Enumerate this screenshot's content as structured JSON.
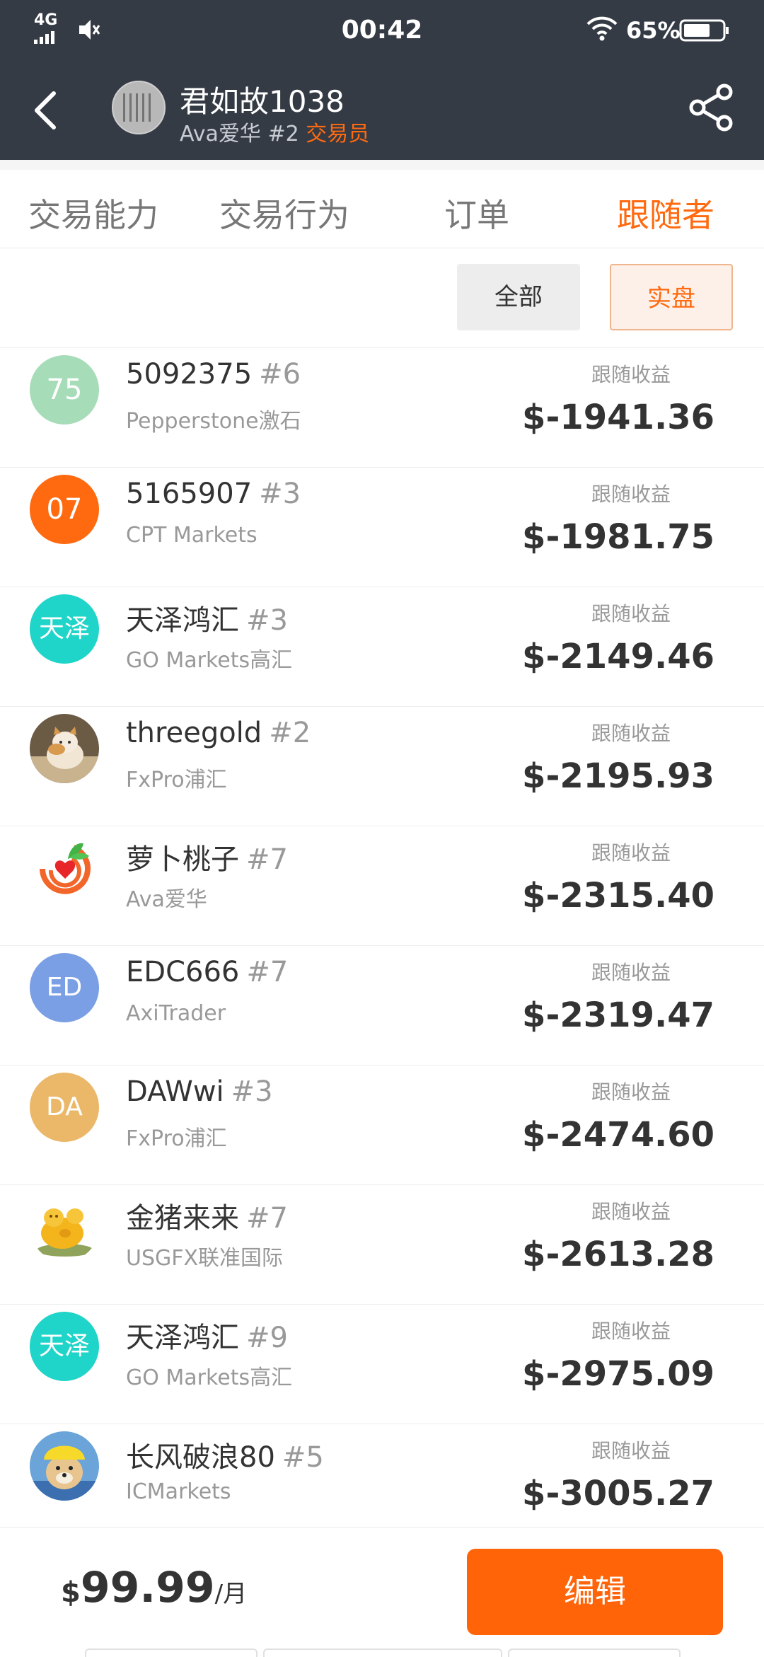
{
  "status": {
    "network": "4G",
    "time": "00:42",
    "battery": "65%"
  },
  "header": {
    "title": "君如故1038",
    "subtitle_broker": "Ava爱华",
    "subtitle_rank": "#2",
    "subtitle_role": "交易员"
  },
  "tabs": [
    {
      "label": "交易能力"
    },
    {
      "label": "交易行为"
    },
    {
      "label": "订单"
    },
    {
      "label": "跟随者",
      "active": true
    }
  ],
  "filters": {
    "all_label": "全部",
    "real_label": "实盘",
    "selected": "实盘"
  },
  "followers": [
    {
      "avatar_text": "75",
      "avatar_color": "#a7dcb8",
      "name": "5092375",
      "rank": "#6",
      "broker": "Pepperstone激石",
      "profit_label": "跟随收益",
      "profit": "$-1941.36"
    },
    {
      "avatar_text": "07",
      "avatar_color": "#ff6a10",
      "name": "5165907",
      "rank": "#3",
      "broker": "CPT Markets",
      "profit_label": "跟随收益",
      "profit": "$-1981.75"
    },
    {
      "avatar_text": "天泽",
      "avatar_color": "#1fd4c8",
      "name": "天泽鸿汇",
      "rank": "#3",
      "broker": "GO Markets高汇",
      "profit_label": "跟随收益",
      "profit": "$-2149.46"
    },
    {
      "avatar_icon": "cat-photo",
      "name": "threegold",
      "rank": "#2",
      "broker": "FxPro浦汇",
      "profit_label": "跟随收益",
      "profit": "$-2195.93"
    },
    {
      "avatar_icon": "radish-logo",
      "name": "萝卜桃子",
      "rank": "#7",
      "broker": "Ava爱华",
      "profit_label": "跟随收益",
      "profit": "$-2315.40"
    },
    {
      "avatar_text": "ED",
      "avatar_color": "#7b9fe4",
      "name": "EDC666",
      "rank": "#7",
      "broker": "AxiTrader",
      "profit_label": "跟随收益",
      "profit": "$-2319.47"
    },
    {
      "avatar_text": "DA",
      "avatar_color": "#ebb86a",
      "name": "DAWwi",
      "rank": "#3",
      "broker": "FxPro浦汇",
      "profit_label": "跟随收益",
      "profit": "$-2474.60"
    },
    {
      "avatar_icon": "golden-pig",
      "name": "金猪来来",
      "rank": "#7",
      "broker": "USGFX联准国际",
      "profit_label": "跟随收益",
      "profit": "$-2613.28"
    },
    {
      "avatar_text": "天泽",
      "avatar_color": "#1fd4c8",
      "name": "天泽鸿汇",
      "rank": "#9",
      "broker": "GO Markets高汇",
      "profit_label": "跟随收益",
      "profit": "$-2975.09"
    },
    {
      "avatar_icon": "dog-photo",
      "name": "长风破浪80",
      "rank": "#5",
      "broker": "ICMarkets",
      "profit_label": "跟随收益",
      "profit": "$-3005.27"
    }
  ],
  "bottom": {
    "currency": "$",
    "price": "99.99",
    "unit": "/月",
    "edit_label": "编辑"
  },
  "colors": {
    "accent": "#ff6a10",
    "header_bg": "#353b45"
  }
}
